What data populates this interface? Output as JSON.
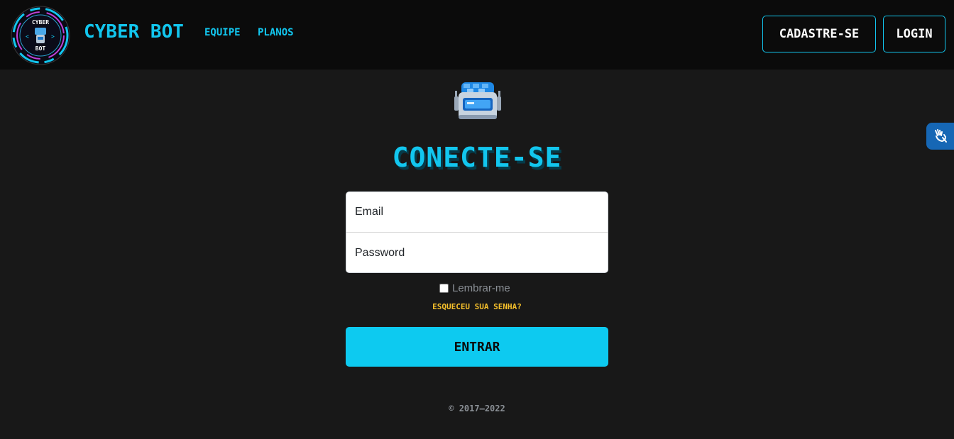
{
  "header": {
    "logo_text_top": "CYBER",
    "logo_text_bottom": "BOT",
    "brand": "CYBER BOT",
    "nav": {
      "equipe": "EQUIPE",
      "planos": "PLANOS"
    },
    "buttons": {
      "signup": "CADASTRE-SE",
      "login": "LOGIN"
    }
  },
  "main": {
    "robot_icon": "robot-icon",
    "title": "CONECTE-SE",
    "form": {
      "email_placeholder": "Email",
      "password_placeholder": "Password",
      "remember_label": "Lembrar-me",
      "remember_checked": false,
      "forgot_link": "ESQUECEU SUA SENHA?",
      "submit": "ENTRAR"
    },
    "copyright": "© 2017–2022"
  },
  "accessibility_widget": {
    "icon": "sign-language-hands-icon"
  },
  "colors": {
    "accent": "#12c6ee",
    "button": "#0dcaf0",
    "link_warning": "#f6c02b",
    "header_bg": "#0b0b0b",
    "page_bg": "#181818",
    "a11y_bg": "#1667b5"
  }
}
